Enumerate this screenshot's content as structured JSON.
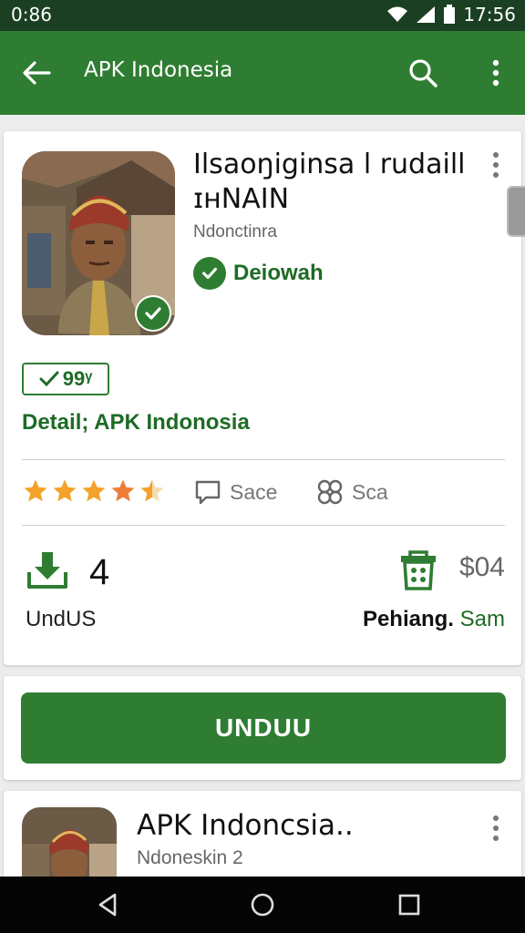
{
  "status_bar": {
    "time_left": "0:86",
    "time_right": "17:56"
  },
  "app_bar": {
    "title": "APK Indonesia"
  },
  "app": {
    "name": "Ilsaoŋiginsa l rudaill ɪʜNAIN",
    "developer": "Ndonctinra",
    "verified_label": "Deiowah",
    "score": "99ᵞ",
    "detail": "Detail; APK Indonosia",
    "rating": 4.5,
    "share_label": "Sace",
    "scan_label": "Sca",
    "downloads": {
      "value": "4",
      "label": "UndUS"
    },
    "price": {
      "value": "$04",
      "label_a": "Pehiang.",
      "label_b": "Sam"
    }
  },
  "install_button": {
    "label": "UNDUU"
  },
  "list_item": {
    "name": "APK Indoncsia..",
    "subtitle": "Ndoneskin 2"
  },
  "colors": {
    "brand": "#2e7d32",
    "status_bar": "#1b3f22",
    "star": "#f4a22a"
  }
}
